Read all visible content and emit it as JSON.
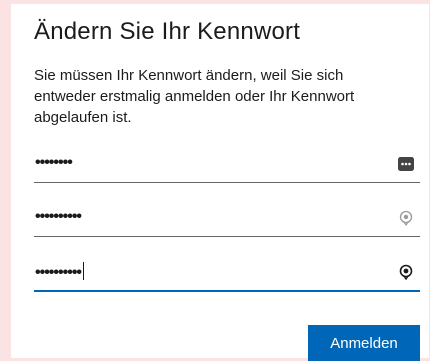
{
  "dialog": {
    "title": "Ändern Sie Ihr Kennwort",
    "description": "Sie müssen Ihr Kennwort ändern, weil Sie sich entweder erstmalig anmelden oder Ihr Kennwort abgelaufen ist."
  },
  "fields": [
    {
      "value": "••••••••",
      "icon": "password-manager-icon"
    },
    {
      "value": "••••••••••",
      "icon": "reveal-password-icon"
    },
    {
      "value": "••••••••••",
      "icon": "reveal-password-icon"
    }
  ],
  "submit_label": "Anmelden",
  "colors": {
    "background": "#fbe3e3",
    "accent": "#0067b8",
    "text": "#1b1b1b"
  }
}
